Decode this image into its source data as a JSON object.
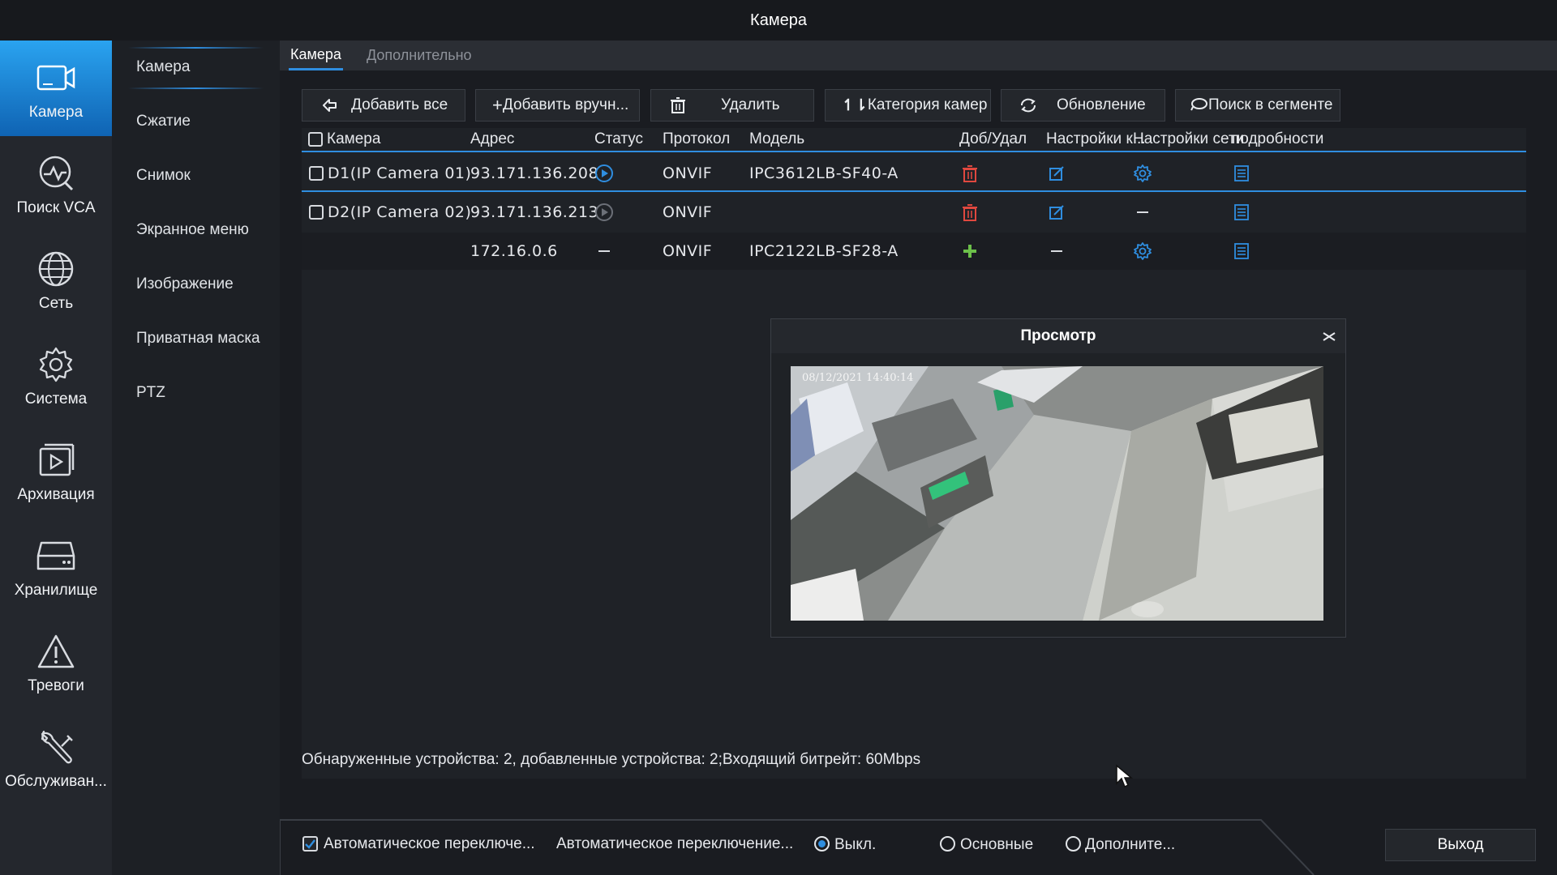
{
  "window": {
    "title": "Камера"
  },
  "nav": {
    "items": [
      {
        "label": "Камера",
        "icon": "camera-icon"
      },
      {
        "label": "Поиск VCA",
        "icon": "vca-search-icon"
      },
      {
        "label": "Сеть",
        "icon": "globe-icon"
      },
      {
        "label": "Система",
        "icon": "gear-icon"
      },
      {
        "label": "Архивация",
        "icon": "playback-icon"
      },
      {
        "label": "Хранилище",
        "icon": "storage-icon"
      },
      {
        "label": "Тревоги",
        "icon": "warning-icon"
      },
      {
        "label": "Обслуживан...",
        "icon": "wrench-icon"
      }
    ]
  },
  "subnav": {
    "items": [
      "Камера",
      "Сжатие",
      "Снимок",
      "Экранное меню",
      "Изображение",
      "Приватная маска",
      "PTZ"
    ]
  },
  "tabs": [
    "Камера",
    "Дополнительно"
  ],
  "toolbar": {
    "add_all": "Добавить все",
    "add_manual": "Добавить вручн...",
    "delete": "Удалить",
    "category": "Категория камер",
    "refresh": "Обновление",
    "search_segment": "Поиск в сегменте"
  },
  "table": {
    "headers": [
      "Камера",
      "Адрес",
      "Статус",
      "Протокол",
      "Модель",
      "Доб/Удал",
      "Настройки к...",
      "Настройки сети",
      "подробности"
    ],
    "rows": [
      {
        "camera": "D1(IP Camera 01)",
        "address": "93.171.136.208",
        "protocol": "ONVIF",
        "model": "IPC3612LB-SF40-A"
      },
      {
        "camera": "D2(IP Camera 02)",
        "address": "93.171.136.213",
        "protocol": "ONVIF",
        "model": ""
      },
      {
        "camera": "",
        "address": "172.16.0.6",
        "protocol": "ONVIF",
        "model": "IPC2122LB-SF28-A"
      }
    ]
  },
  "preview": {
    "title": "Просмотр",
    "osd_timestamp": "08/12/2021 14:40:14"
  },
  "status_text": "Обнаруженные устройства: 2, добавленные устройства: 2;Входящий битрейт: 60Mbps",
  "bottom": {
    "auto_switch_checkbox": "Автоматическое переключе...",
    "auto_switch_label": "Автоматическое переключение...",
    "radio_off": "Выкл.",
    "radio_main": "Основные",
    "radio_extra": "Дополните...",
    "exit": "Выход"
  },
  "colors": {
    "accent": "#2f8ee0",
    "delete_red": "#e0483f",
    "add_green": "#6cc04a"
  }
}
